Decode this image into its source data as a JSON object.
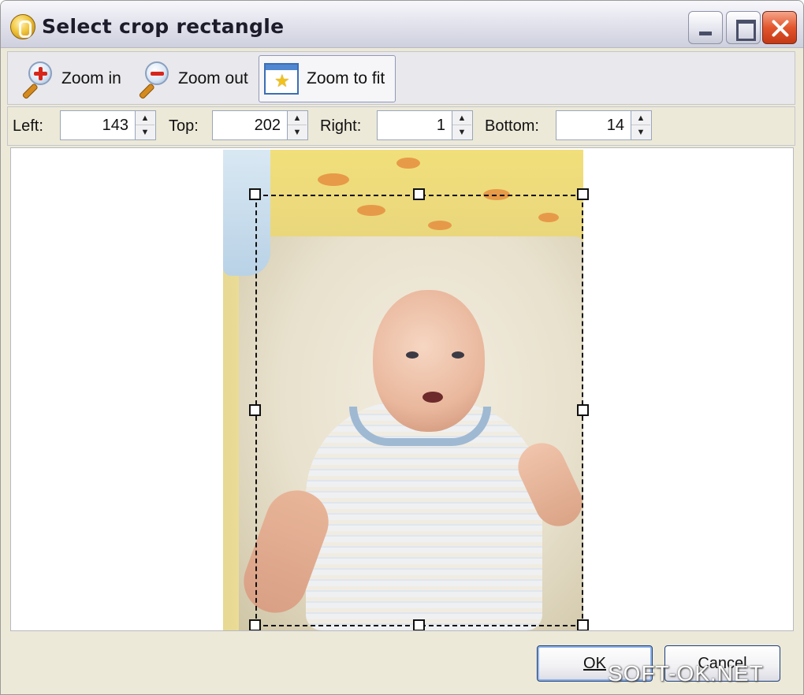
{
  "window": {
    "title": "Select crop rectangle",
    "controls": [
      "minimize",
      "maximize",
      "close"
    ]
  },
  "toolbar": {
    "zoom_in": "Zoom in",
    "zoom_out": "Zoom out",
    "zoom_to_fit": "Zoom to fit"
  },
  "crop": {
    "left_label": "Left:",
    "left_value": "143",
    "top_label": "Top:",
    "top_value": "202",
    "right_label": "Right:",
    "right_value": "1",
    "bottom_label": "Bottom:",
    "bottom_value": "14"
  },
  "buttons": {
    "ok": "OK",
    "cancel": "Cancel"
  },
  "watermark": "SOFT-OK.NET",
  "icons": {
    "app": "coin-app-icon",
    "zoom_in": "magnifier-plus-icon",
    "zoom_out": "magnifier-minus-icon",
    "zoom_fit": "window-star-icon"
  },
  "colors": {
    "window_bg": "#ece9d8",
    "close_button": "#e2552d",
    "selection_border": "#111111"
  }
}
